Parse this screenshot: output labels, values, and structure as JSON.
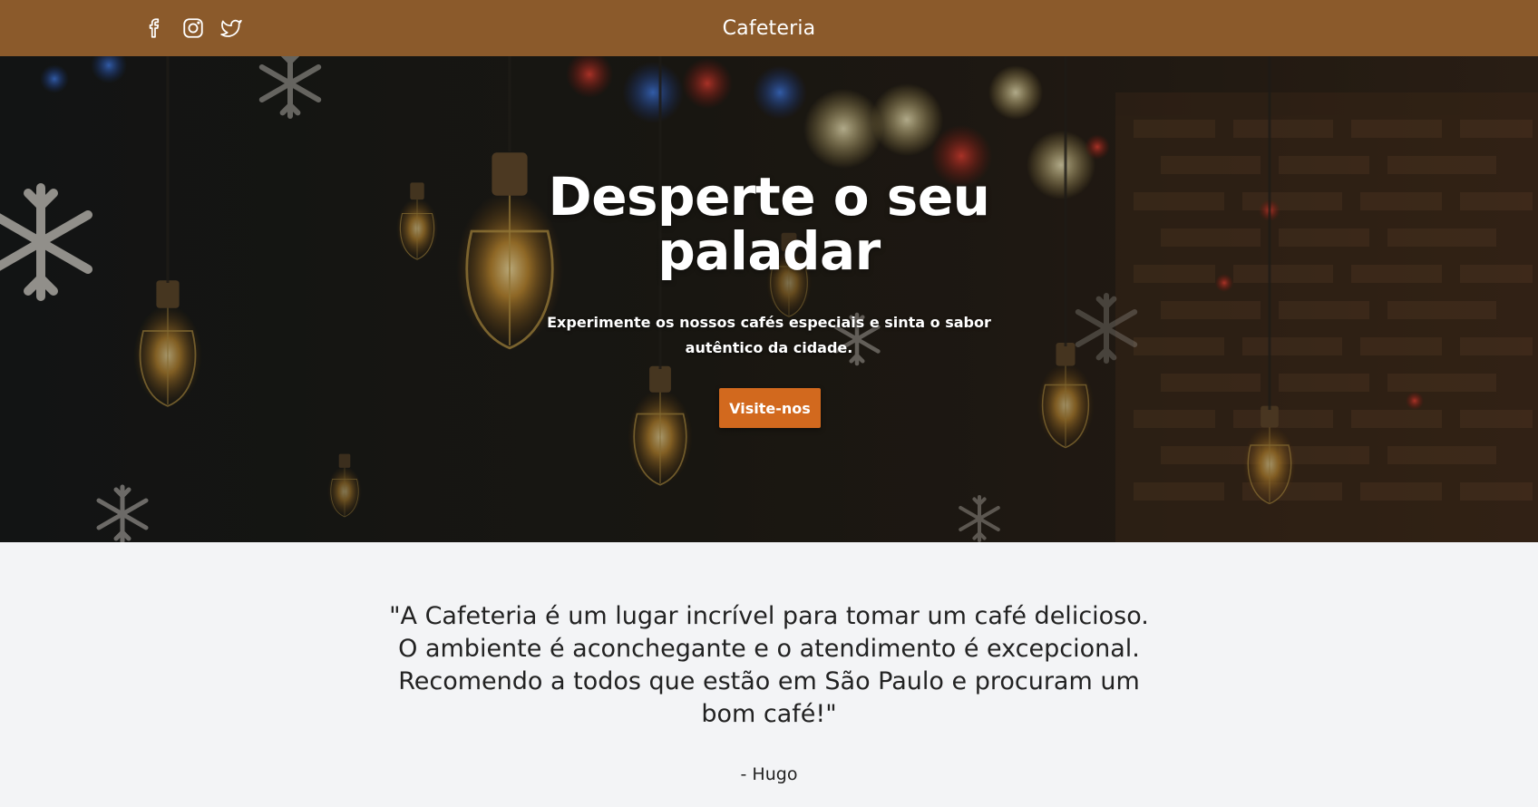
{
  "header": {
    "brand": "Cafeteria",
    "social_icons": [
      "facebook-icon",
      "instagram-icon",
      "twitter-icon"
    ],
    "background_color": "#8b5a2b"
  },
  "hero": {
    "title": "Desperte o seu paladar",
    "subtitle": "Experimente os nossos cafés especiais e sinta o sabor autêntico da cidade.",
    "button_label": "Visite-nos",
    "button_color": "#d2691e"
  },
  "testimonial": {
    "quote": "\"A Cafeteria é um lugar incrível para tomar um café delicioso. O ambiente é aconchegante e o atendimento é excepcional. Recomendo a todos que estão em São Paulo e procuram um bom café!\"",
    "author": "- Hugo"
  }
}
